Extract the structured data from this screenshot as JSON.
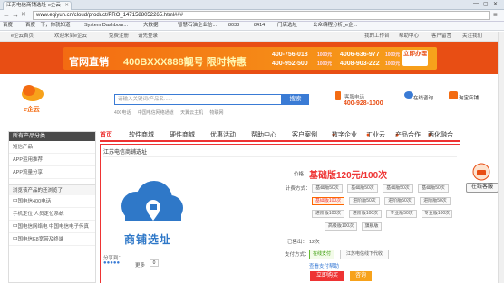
{
  "browser": {
    "tab_title": "江苏电信商铺选址-e企云",
    "url": "www.eqiyun.cn/cloud/product/PRO_1471588052265.html###"
  },
  "bookmarks": [
    "百度",
    "百度一下，你就知道",
    "System Dashboar...",
    "大数据",
    "智慧石油企业信...",
    "8033",
    "8414",
    "门店选址",
    "公众编程分析_e企..."
  ],
  "topnav": {
    "left": [
      "e企云首页",
      "欢迎来到e企云",
      "免费注册",
      "请先登录"
    ],
    "right": [
      "我的工作台",
      "帮助中心",
      "客户留言",
      "关注我们"
    ]
  },
  "banner": {
    "title": "官网直销",
    "subtitle": "400BXXX888靓号 限时特惠",
    "numbers": [
      "400-756-018",
      "4006-636-977",
      "400-952-500",
      "4008-903-222"
    ],
    "prices": [
      "1000元",
      "1000元",
      "1000元",
      "1000元"
    ],
    "cta": "立即办理"
  },
  "header": {
    "logo": "e企云",
    "search_placeholder": "请输入关键词/产品名......",
    "search_button": "搜索",
    "hot": [
      "400电话",
      "中国电信网络通道",
      "天翼云主机",
      "物联网"
    ],
    "phone_label": "客服电话",
    "phone": "400-928-1000",
    "online_service": "在线咨询",
    "taobao_store": "淘宝店铺"
  },
  "sidebar": {
    "title": "所有产品分类",
    "items": [
      "短信产品",
      "APP运用推荐",
      "APP流量分享"
    ],
    "recent_title": "浏览该产品的还浏览了",
    "recent": [
      "中国电信400电话",
      "手机定位 人员定位系统",
      "中国电信网络电 中国电信电子传真",
      "中国电信E8宽带及终端"
    ]
  },
  "menu": [
    "首页",
    "软件商城",
    "硬件商城",
    "优惠活动",
    "帮助中心",
    "客户案例",
    "数字企业",
    "工业云",
    "产品合作",
    "两化融合"
  ],
  "product": {
    "name": "江苏电信商铺选址",
    "image_text": "商铺选址",
    "price_label": "价格：",
    "price": "基础版120元/100次",
    "plan_label": "计费方式：",
    "plans": [
      "基础版50次",
      "基础版50次",
      "基础版50次",
      "基础版50次",
      "基础版100次",
      "进阶版50次",
      "进阶版50次",
      "进阶版50次",
      "进阶版100次",
      "进阶版100次",
      "专业版50次",
      "专业版100次",
      "高级版100次",
      "旗舰版"
    ],
    "sold_label": "已售出：",
    "sold": "12次",
    "pay_label": "支付方式：",
    "pay_options": [
      "在线支付",
      "江苏电信线下代收"
    ],
    "pay_hint": "查看支付帮助",
    "buy_now": "立即购买",
    "consult": "咨询",
    "share": "分享到：",
    "more": "更多"
  },
  "right_widget": {
    "label": "在线客服"
  },
  "colors": {
    "accent_red": "#e33333",
    "banner_orange": "#e84e14",
    "brand_blue": "#3a7bd5"
  }
}
